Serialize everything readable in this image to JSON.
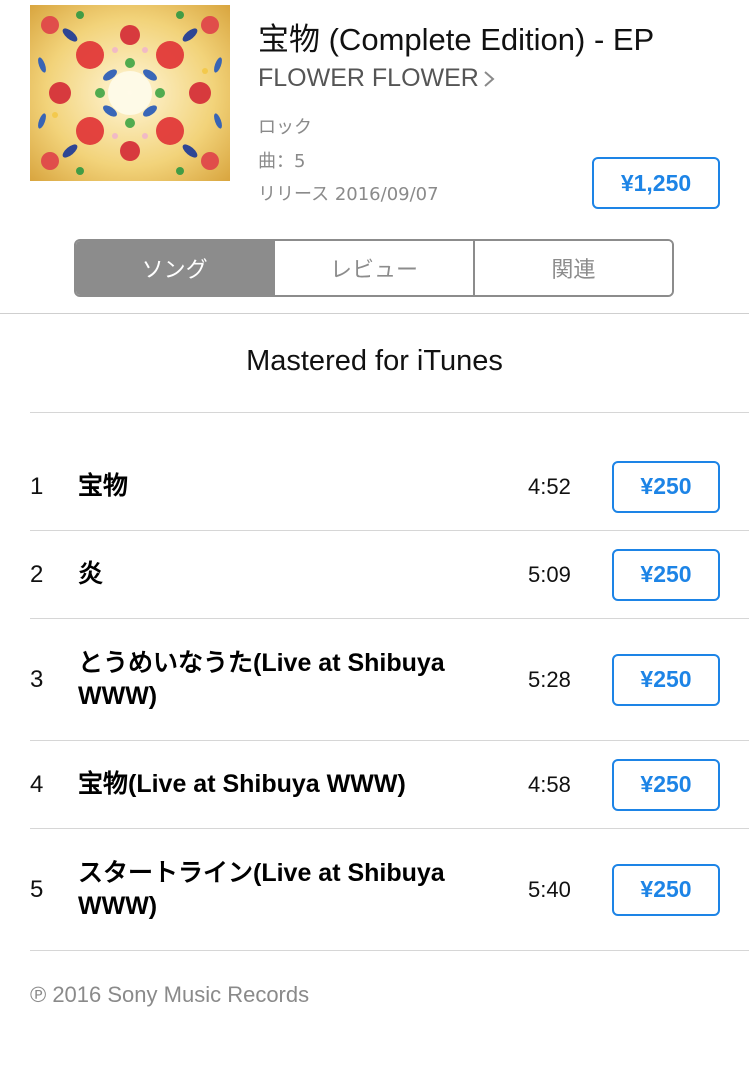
{
  "album": {
    "title": "宝物 (Complete Edition) - EP",
    "artist": "FLOWER FLOWER",
    "genre": "ロック",
    "track_count": "曲：5",
    "release": "リリース 2016/09/07",
    "price": "¥1,250",
    "artwork_icon": "album-artwork-image"
  },
  "tabs": [
    {
      "label": "ソング",
      "active": true
    },
    {
      "label": "レビュー",
      "active": false
    },
    {
      "label": "関連",
      "active": false
    }
  ],
  "section": {
    "title": "Mastered for iTunes"
  },
  "tracks": [
    {
      "number": "1",
      "title": "宝物",
      "duration": "4:52",
      "price": "¥250"
    },
    {
      "number": "2",
      "title": "炎",
      "duration": "5:09",
      "price": "¥250"
    },
    {
      "number": "3",
      "title": "とうめいなうた(Live at Shibuya WWW)",
      "duration": "5:28",
      "price": "¥250"
    },
    {
      "number": "4",
      "title": "宝物(Live at Shibuya WWW)",
      "duration": "4:58",
      "price": "¥250"
    },
    {
      "number": "5",
      "title": "スタートライン(Live at Shibuya WWW)",
      "duration": "5:40",
      "price": "¥250"
    }
  ],
  "footer": {
    "copyright": "℗ 2016 Sony Music Records"
  },
  "colors": {
    "accent": "#1d84e6",
    "segment": "#8c8c8c",
    "secondary_text": "#8a8a8a"
  }
}
